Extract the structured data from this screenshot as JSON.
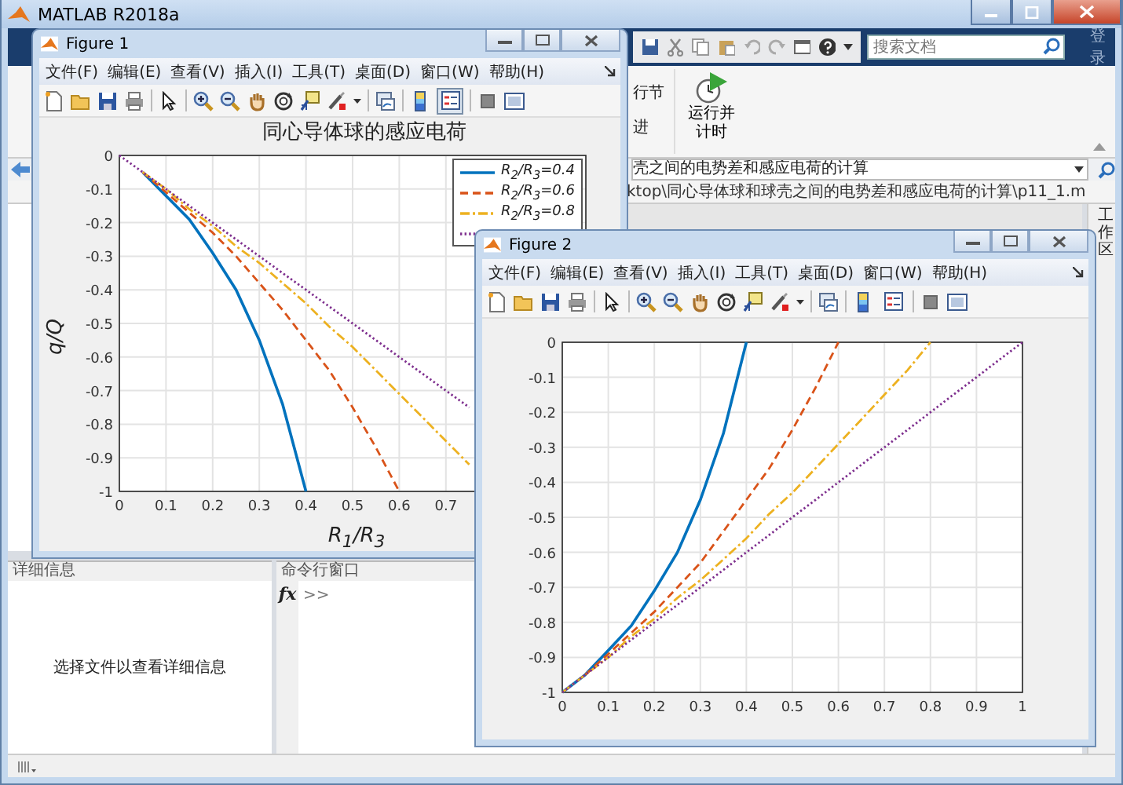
{
  "main_window": {
    "title": "MATLAB R2018a"
  },
  "toolstrip": {
    "search": {
      "placeholder": "搜索文档"
    },
    "sign_in": "登录",
    "partial_labels": [
      "行节",
      "进"
    ],
    "run_and_time": [
      "运行并",
      "计时"
    ]
  },
  "address_bar": {
    "value": "壳之间的电势差和感应电荷的计算"
  },
  "file_path": "ktop\\同心导体球和球壳之间的电势差和感应电荷的计算\\p11_1.m",
  "workspace_tab": "工作区",
  "details_panel": {
    "title": "详细信息",
    "message": "选择文件以查看详细信息"
  },
  "command_window": {
    "title": "命令行窗口",
    "fx": "fx",
    "prompt": ">>"
  },
  "figures": [
    {
      "title": "Figure 1",
      "menu": [
        "文件(F)",
        "编辑(E)",
        "查看(V)",
        "插入(I)",
        "工具(T)",
        "桌面(D)",
        "窗口(W)",
        "帮助(H)"
      ],
      "legend_button_pressed": true,
      "chart_data": {
        "type": "line",
        "title": "同心导体球的感应电荷",
        "xlabel": "R$_{1}$/R$_{3}$",
        "ylabel": "q/Q",
        "grid": true,
        "legend": true,
        "x": [
          0,
          0.05,
          0.1,
          0.15,
          0.2,
          0.25,
          0.3,
          0.35,
          0.4,
          0.45,
          0.5,
          0.55,
          0.6,
          0.65,
          0.7,
          0.75
        ],
        "xlim": [
          0,
          1
        ],
        "ylim": [
          -1,
          0
        ],
        "xticks": [
          0,
          0.1,
          0.2,
          0.3,
          0.4,
          0.5,
          0.6,
          0.7
        ],
        "yticks": [
          0,
          -0.1,
          -0.2,
          -0.3,
          -0.4,
          -0.5,
          -0.6,
          -0.7,
          -0.8,
          -0.9,
          -1
        ],
        "series": [
          {
            "name": "R$_{2}$/R$_{3}$=0.4",
            "color": "#0072bd",
            "line_style": "solid",
            "values": [
              null,
              -0.05,
              -0.12,
              -0.19,
              -0.29,
              -0.4,
              -0.55,
              -0.74,
              -1,
              null,
              null,
              null,
              null,
              null,
              null,
              null
            ]
          },
          {
            "name": "R$_{2}$/R$_{3}$=0.6",
            "color": "#d95319",
            "line_style": "dashed",
            "values": [
              null,
              -0.05,
              -0.11,
              -0.17,
              -0.23,
              -0.3,
              -0.38,
              -0.46,
              -0.55,
              -0.64,
              -0.75,
              -0.87,
              -1,
              null,
              null,
              null
            ]
          },
          {
            "name": "R$_{2}$/R$_{3}$=0.8",
            "color": "#edb120",
            "line_style": "dashdot",
            "values": [
              null,
              -0.05,
              -0.1,
              -0.16,
              -0.21,
              -0.27,
              -0.32,
              -0.38,
              -0.44,
              -0.51,
              -0.57,
              -0.64,
              -0.71,
              -0.78,
              -0.85,
              -0.92
            ]
          },
          {
            "color": "#7e2f8e",
            "line_style": "dotted",
            "values": [
              0,
              -0.05,
              -0.1,
              -0.15,
              -0.2,
              -0.25,
              -0.3,
              -0.35,
              -0.4,
              -0.45,
              -0.5,
              -0.55,
              -0.6,
              -0.65,
              -0.7,
              -0.75
            ]
          }
        ]
      }
    },
    {
      "title": "Figure 2",
      "menu": [
        "文件(F)",
        "编辑(E)",
        "查看(V)",
        "插入(I)",
        "工具(T)",
        "桌面(D)",
        "窗口(W)",
        "帮助(H)"
      ],
      "legend_button_pressed": false,
      "chart_data": {
        "type": "line",
        "grid": true,
        "x": [
          0,
          0.05,
          0.1,
          0.15,
          0.2,
          0.25,
          0.3,
          0.35,
          0.4,
          0.45,
          0.5,
          0.55,
          0.6,
          0.65,
          0.7,
          0.75,
          0.8,
          0.85,
          0.9,
          0.95,
          1
        ],
        "xlim": [
          0,
          1
        ],
        "ylim": [
          -1,
          0
        ],
        "xticks": [
          0,
          0.1,
          0.2,
          0.3,
          0.4,
          0.5,
          0.6,
          0.7,
          0.8,
          0.9,
          1
        ],
        "yticks": [
          0,
          -0.1,
          -0.2,
          -0.3,
          -0.4,
          -0.5,
          -0.6,
          -0.7,
          -0.8,
          -0.9,
          -1
        ],
        "series": [
          {
            "color": "#0072bd",
            "line_style": "solid",
            "values": [
              -1,
              -0.95,
              -0.88,
              -0.81,
              -0.71,
              -0.6,
              -0.45,
              -0.26,
              0,
              null,
              null,
              null,
              null,
              null,
              null,
              null,
              null,
              null,
              null,
              null,
              null
            ]
          },
          {
            "color": "#d95319",
            "line_style": "dashed",
            "values": [
              null,
              -0.95,
              -0.89,
              -0.83,
              -0.77,
              -0.7,
              -0.63,
              -0.54,
              -0.45,
              -0.36,
              -0.25,
              -0.13,
              0,
              null,
              null,
              null,
              null,
              null,
              null,
              null,
              null
            ]
          },
          {
            "color": "#edb120",
            "line_style": "dashdot",
            "values": [
              -1,
              -0.95,
              -0.9,
              -0.84,
              -0.79,
              -0.73,
              -0.68,
              -0.62,
              -0.56,
              -0.49,
              -0.43,
              -0.36,
              -0.29,
              -0.22,
              -0.15,
              -0.08,
              0,
              null,
              null,
              null,
              null
            ]
          },
          {
            "color": "#7e2f8e",
            "line_style": "dotted",
            "values": [
              -1,
              -0.95,
              -0.9,
              -0.85,
              -0.8,
              -0.75,
              -0.7,
              -0.65,
              -0.6,
              -0.55,
              -0.5,
              -0.45,
              -0.4,
              -0.35,
              -0.3,
              -0.25,
              -0.2,
              -0.15,
              -0.1,
              -0.05,
              0
            ]
          }
        ]
      }
    }
  ]
}
